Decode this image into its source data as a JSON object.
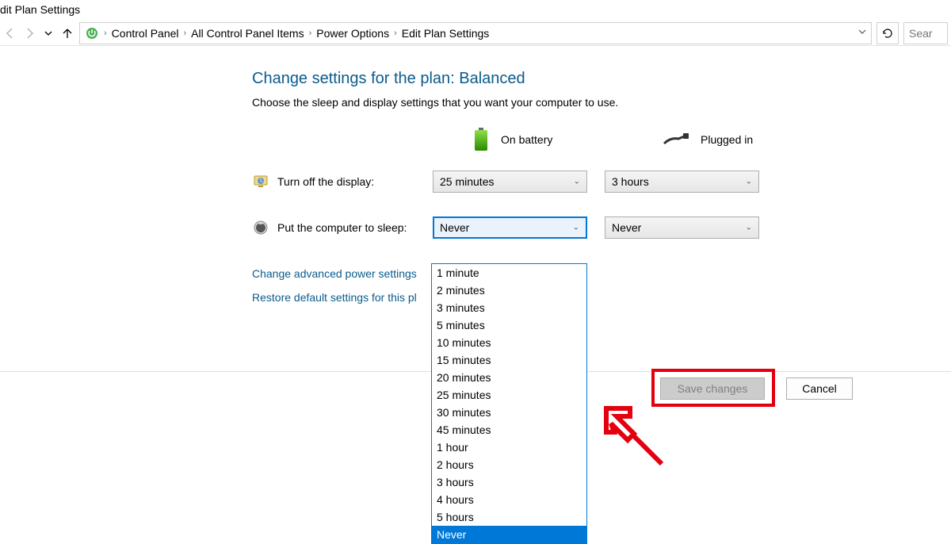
{
  "window": {
    "title": "dit Plan Settings"
  },
  "nav": {
    "breadcrumb": [
      "Control Panel",
      "All Control Panel Items",
      "Power Options",
      "Edit Plan Settings"
    ],
    "search_placeholder": "Sear"
  },
  "page": {
    "title": "Change settings for the plan: Balanced",
    "subtitle": "Choose the sleep and display settings that you want your computer to use."
  },
  "columns": {
    "battery": "On battery",
    "plugged": "Plugged in"
  },
  "rows": {
    "display": {
      "label": "Turn off the display:",
      "battery_value": "25 minutes",
      "plugged_value": "3 hours"
    },
    "sleep": {
      "label": "Put the computer to sleep:",
      "battery_value": "Never",
      "plugged_value": "Never"
    }
  },
  "dropdown_options": [
    "1 minute",
    "2 minutes",
    "3 minutes",
    "5 minutes",
    "10 minutes",
    "15 minutes",
    "20 minutes",
    "25 minutes",
    "30 minutes",
    "45 minutes",
    "1 hour",
    "2 hours",
    "3 hours",
    "4 hours",
    "5 hours",
    "Never"
  ],
  "dropdown_selected": "Never",
  "links": {
    "advanced": "Change advanced power settings",
    "restore": "Restore default settings for this pl"
  },
  "buttons": {
    "save": "Save changes",
    "cancel": "Cancel"
  }
}
